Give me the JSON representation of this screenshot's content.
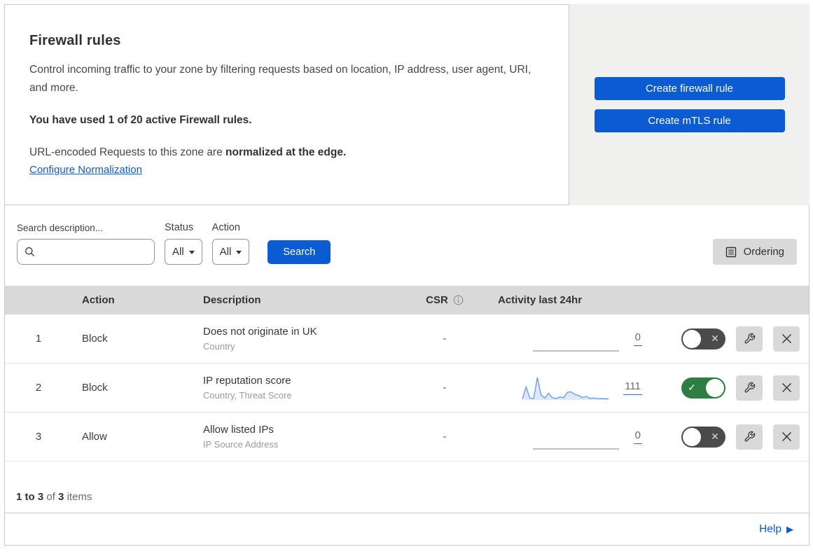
{
  "header": {
    "title": "Firewall rules",
    "description": "Control incoming traffic to your zone by filtering requests based on location, IP address, user agent, URI, and more.",
    "usage": "You have used 1 of 20 active Firewall rules.",
    "normalization_prefix": "URL-encoded Requests to this zone are ",
    "normalization_bold": "normalized at the edge.",
    "normalization_link": "Configure Normalization",
    "create_firewall_button": "Create firewall rule",
    "create_mtls_button": "Create mTLS rule"
  },
  "filters": {
    "search_label": "Search description...",
    "search_placeholder": "",
    "status_label": "Status",
    "status_value": "All",
    "action_label": "Action",
    "action_value": "All",
    "search_button": "Search",
    "ordering_button": "Ordering"
  },
  "table": {
    "columns": {
      "action": "Action",
      "description": "Description",
      "csr": "CSR",
      "activity": "Activity last 24hr"
    },
    "rows": [
      {
        "index": "1",
        "action": "Block",
        "description": "Does not originate in UK",
        "criteria": "Country",
        "csr": "-",
        "enabled": false,
        "activity": {
          "count": "0",
          "points": [
            0,
            0
          ],
          "stroke": "#ababab",
          "fill": null
        }
      },
      {
        "index": "2",
        "action": "Block",
        "description": "IP reputation score",
        "criteria": "Country, Threat Score",
        "csr": "-",
        "enabled": true,
        "activity": {
          "count": "111",
          "points": [
            4,
            58,
            8,
            6,
            100,
            22,
            8,
            30,
            10,
            7,
            13,
            9,
            34,
            36,
            24,
            20,
            10,
            16,
            7,
            9,
            6,
            6,
            5,
            5
          ],
          "stroke": "#76a3e2",
          "fill": "#dde8f8"
        }
      },
      {
        "index": "3",
        "action": "Allow",
        "description": "Allow listed IPs",
        "criteria": "IP Source Address",
        "csr": "-",
        "enabled": false,
        "activity": {
          "count": "0",
          "points": [
            0,
            0
          ],
          "stroke": "#ababab",
          "fill": null
        }
      }
    ]
  },
  "chart_data": {
    "type": "area",
    "title": "Activity last 24hr sparkline (rule 2)",
    "x": "last 24 hours",
    "values": [
      4,
      58,
      8,
      6,
      100,
      22,
      8,
      30,
      10,
      7,
      13,
      9,
      34,
      36,
      24,
      20,
      10,
      16,
      7,
      9,
      6,
      6,
      5,
      5
    ],
    "total": 111
  },
  "footer": {
    "range": "1 to 3",
    "of": "of",
    "total": "3",
    "items": "items"
  },
  "help": {
    "label": "Help"
  },
  "icons": {
    "check": "✓",
    "cross": "✕",
    "help_arrow": "▶"
  },
  "colors": {
    "accent_blue": "#0b5bd3",
    "toggle_on_green": "#2e7d43",
    "toggle_off_gray": "#4b4b4b",
    "header_band": "#d9d9d9",
    "panel_gray": "#f0f0ef",
    "sparkline_blue": "#76a3e2"
  }
}
